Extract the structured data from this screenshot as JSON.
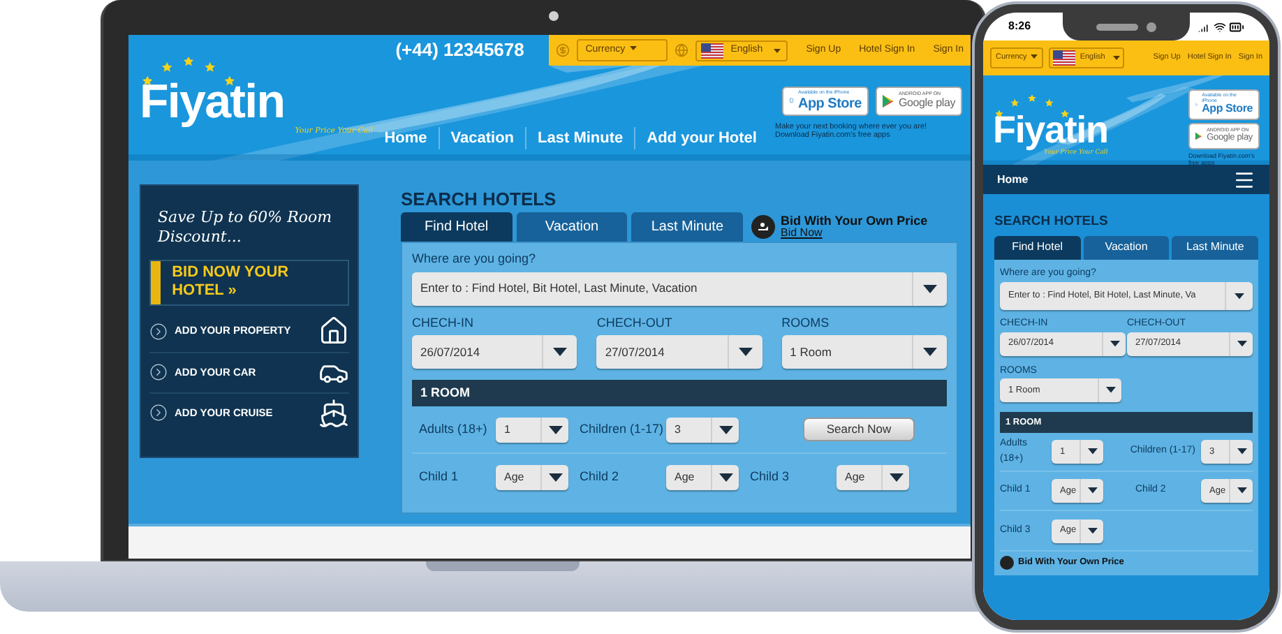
{
  "laptop": {
    "phone_number": "(+44) 12345678",
    "currency": "Currency",
    "language": "English",
    "top_links": [
      "Sign Up",
      "Hotel Sign In",
      "Sign In"
    ],
    "logo": {
      "name": "Fiyatin",
      "tagline": "Your Price Your Call"
    },
    "app_badges": [
      {
        "small": "Available on the iPhone",
        "label": "App Store",
        "kind": "apple"
      },
      {
        "small": "ANDROID APP ON",
        "label": "Google play",
        "kind": "google"
      }
    ],
    "app_note": "Make your next booking where ever you are! Download Fiyatin.com's free apps",
    "nav": [
      "Home",
      "Vacation",
      "Last Minute",
      "Add your Hotel"
    ],
    "promo": {
      "headline": "Save Up to 60% Room Discount...",
      "bid": "BID NOW YOUR HOTEL »",
      "links": [
        {
          "label": "ADD YOUR PROPERTY",
          "kind": "house"
        },
        {
          "label": "ADD YOUR CAR",
          "kind": "car"
        },
        {
          "label": "ADD YOUR CRUISE",
          "kind": "cruise"
        }
      ]
    },
    "search": {
      "title": "SEARCH HOTELS",
      "tabs": [
        {
          "label": "Find Hotel",
          "selected": true
        },
        {
          "label": "Vacation",
          "selected": false
        },
        {
          "label": "Last Minute",
          "selected": false
        }
      ],
      "bid_offer": {
        "title": "Bid With Your Own Price",
        "link": "Bid Now"
      },
      "destination": {
        "label": "Where are you going?",
        "value": "Enter to : Find Hotel, Bit Hotel, Last Minute, Vacation"
      },
      "check_in": {
        "label": "CHECH-IN",
        "value": "26/07/2014"
      },
      "check_out": {
        "label": "CHECH-OUT",
        "value": "27/07/2014"
      },
      "rooms": {
        "label": "ROOMS",
        "value": "1 Room"
      },
      "room_title": "1 ROOM",
      "adults": {
        "label": "Adults (18+)",
        "value": "1"
      },
      "children": {
        "label": "Children (1-17)",
        "value": "3"
      },
      "children_ages": [
        {
          "label": "Child 1",
          "value": "Age"
        },
        {
          "label": "Child 2",
          "value": "Age"
        },
        {
          "label": "Child 3",
          "value": "Age"
        }
      ],
      "search_button": "Search Now"
    }
  },
  "phone": {
    "time": "8:26",
    "currency": "Currency",
    "language": "English",
    "top_links": [
      "Sign Up",
      "Hotel Sign In",
      "Sign In"
    ],
    "logo": {
      "name": "Fiyatin",
      "tagline": "Your Price Your Call"
    },
    "app_badges": [
      {
        "small": "Available on the iPhone",
        "label": "App Store",
        "kind": "apple"
      },
      {
        "small": "ANDROID APP ON",
        "label": "Google play",
        "kind": "google"
      }
    ],
    "app_note": "Download Fiyatin.com's free apps",
    "nav": [
      "Home"
    ],
    "search": {
      "title": "SEARCH HOTELS",
      "tabs": [
        {
          "label": "Find Hotel",
          "selected": true
        },
        {
          "label": "Vacation",
          "selected": false
        },
        {
          "label": "Last Minute",
          "selected": false
        }
      ],
      "destination": {
        "label": "Where are you going?",
        "value": "Enter to : Find Hotel, Bit Hotel, Last Minute, Va"
      },
      "check_in": {
        "label": "CHECH-IN",
        "value": "26/07/2014"
      },
      "check_out": {
        "label": "CHECH-OUT",
        "value": "27/07/2014"
      },
      "rooms": {
        "label": "ROOMS",
        "value": "1 Room"
      },
      "room_title": "1 ROOM",
      "adults": {
        "label": "Adults (18+)",
        "value": "1"
      },
      "children": {
        "label": "Children (1-17)",
        "value": "3"
      },
      "children_ages": [
        {
          "label": "Child 1",
          "value": "Age"
        },
        {
          "label": "Child 2",
          "value": "Age"
        },
        {
          "label": "Child 3",
          "value": "Age"
        }
      ],
      "bid_offer": {
        "title": "Bid With Your Own Price"
      }
    }
  }
}
